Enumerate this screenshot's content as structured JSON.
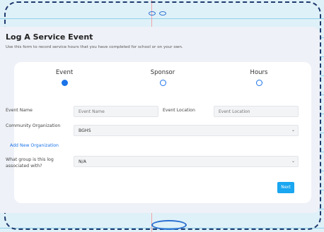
{
  "header": {
    "title": "Log A Service Event",
    "subtitle": "Use this form to record service hours that you have completed for school or on your own."
  },
  "steps": [
    {
      "label": "Event",
      "active": true
    },
    {
      "label": "Sponsor",
      "active": false
    },
    {
      "label": "Hours",
      "active": false
    }
  ],
  "form": {
    "event_name_label": "Event Name",
    "event_name_placeholder": "Event Name",
    "event_location_label": "Event Location",
    "event_location_placeholder": "Event Location",
    "community_org_label": "Community Organization",
    "community_org_value": "BGHS",
    "add_org_link": "Add New Organization",
    "group_label": "What group is this log associated with?",
    "group_value": "N/A",
    "next_button": "Next"
  },
  "colors": {
    "accent": "#1a73e8",
    "button": "#1aa6f0"
  }
}
